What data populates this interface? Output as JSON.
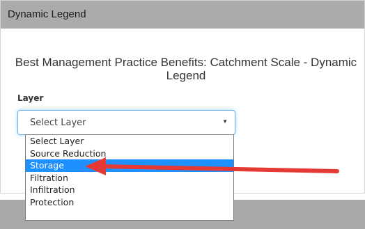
{
  "panel": {
    "header_title": "Dynamic Legend",
    "legend_title": "Best Management Practice Benefits: Catchment Scale - Dynamic Legend"
  },
  "layer": {
    "label": "Layer",
    "selected_value": "Select Layer",
    "options": [
      "Select Layer",
      "Source Reduction",
      "Storage",
      "Filtration",
      "Infiltration",
      "Protection"
    ],
    "highlighted_option": "Storage"
  },
  "colors": {
    "header_bg": "#ababab",
    "highlight": "#1e90ff",
    "annotation_arrow": "#e53935",
    "focus_border": "#66afe9"
  },
  "icons": {
    "select_caret": "caret-down-icon",
    "annotation": "arrow-left-icon"
  }
}
